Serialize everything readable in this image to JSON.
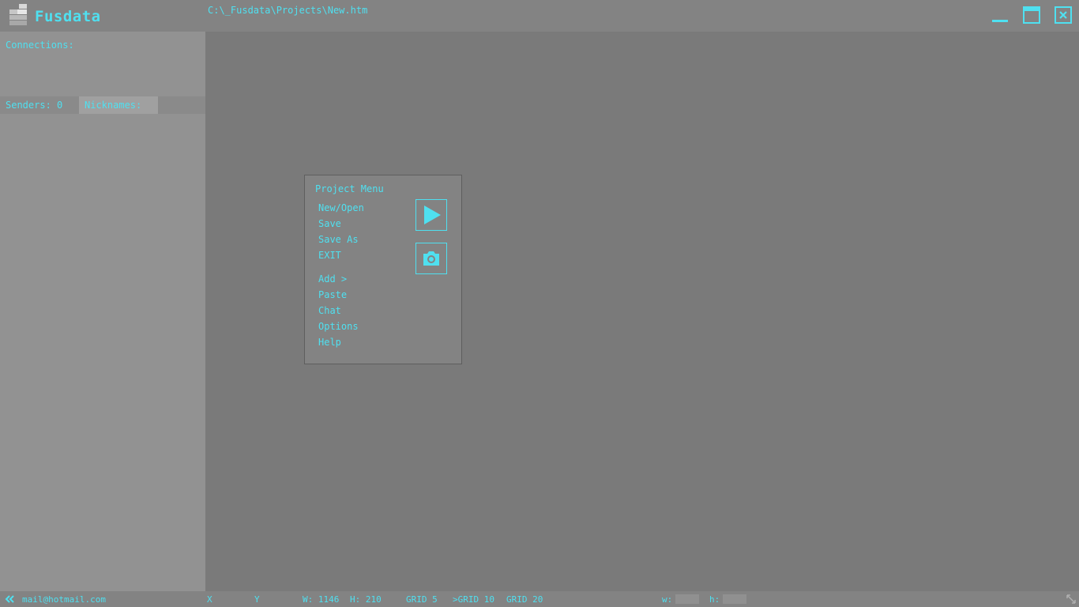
{
  "app": {
    "title": "Fusdata",
    "path": "C:\\_Fusdata\\Projects\\New.htm"
  },
  "sidebar": {
    "connections_label": "Connections:",
    "senders_label": "Senders: 0",
    "nicknames_label": "Nicknames:"
  },
  "menu": {
    "title": "Project Menu",
    "items": [
      "New/Open",
      "Save",
      "Save As",
      "EXIT",
      "Add >",
      "Paste",
      "Chat",
      "Options",
      "Help"
    ]
  },
  "status": {
    "email": "mail@hotmail.com",
    "x_label": "X",
    "y_label": "Y",
    "w_label": "W: 1146",
    "h_label": "H: 210",
    "grid5": "GRID 5",
    "grid10": ">GRID 10",
    "grid20": "GRID 20",
    "w_small": "w:",
    "h_small": "h:"
  },
  "icons": {
    "logo": "stacked-blocks-logo",
    "minimize": "minimize-icon",
    "maximize": "maximize-icon",
    "close": "close-icon",
    "play": "play-icon",
    "camera": "camera-icon",
    "collapse": "double-chevron-left-icon",
    "resize": "resize-icon"
  },
  "colors": {
    "accent": "#4fe0f0",
    "background": "#7a7a7a",
    "panel": "#838383",
    "sidebar": "#929292"
  }
}
